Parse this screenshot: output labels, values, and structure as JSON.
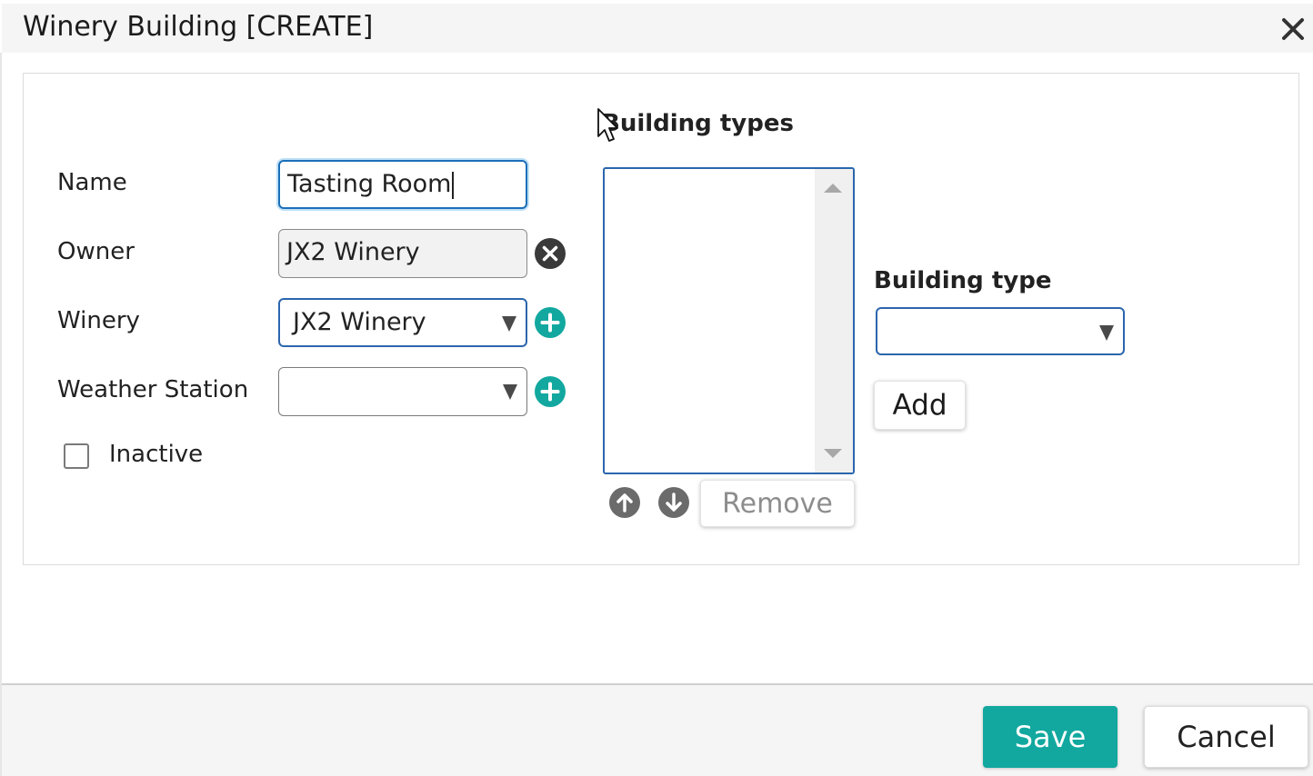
{
  "dialog": {
    "title": "Winery Building [CREATE]"
  },
  "form": {
    "name_label": "Name",
    "name_value": "Tasting Room",
    "owner_label": "Owner",
    "owner_value": "JX2 Winery",
    "winery_label": "Winery",
    "winery_value": "JX2 Winery",
    "weather_station_label": "Weather Station",
    "weather_station_value": "",
    "inactive_label": "Inactive",
    "inactive_checked": false
  },
  "building_types": {
    "section_title": "Building types",
    "items": [],
    "remove_label": "Remove",
    "type_label": "Building type",
    "type_value": "",
    "add_label": "Add"
  },
  "footer": {
    "save_label": "Save",
    "cancel_label": "Cancel"
  },
  "colors": {
    "accent": "#12a89f",
    "focus_border": "#2b66ad",
    "clear_icon": "#3a3a3a",
    "arrow_icon": "#6b6b6b"
  },
  "icons": {
    "close": "close-icon",
    "clear": "clear-circle-icon",
    "add": "add-circle-icon",
    "move_up": "arrow-up-circle-icon",
    "move_down": "arrow-down-circle-icon",
    "dropdown": "chevron-down-icon"
  }
}
